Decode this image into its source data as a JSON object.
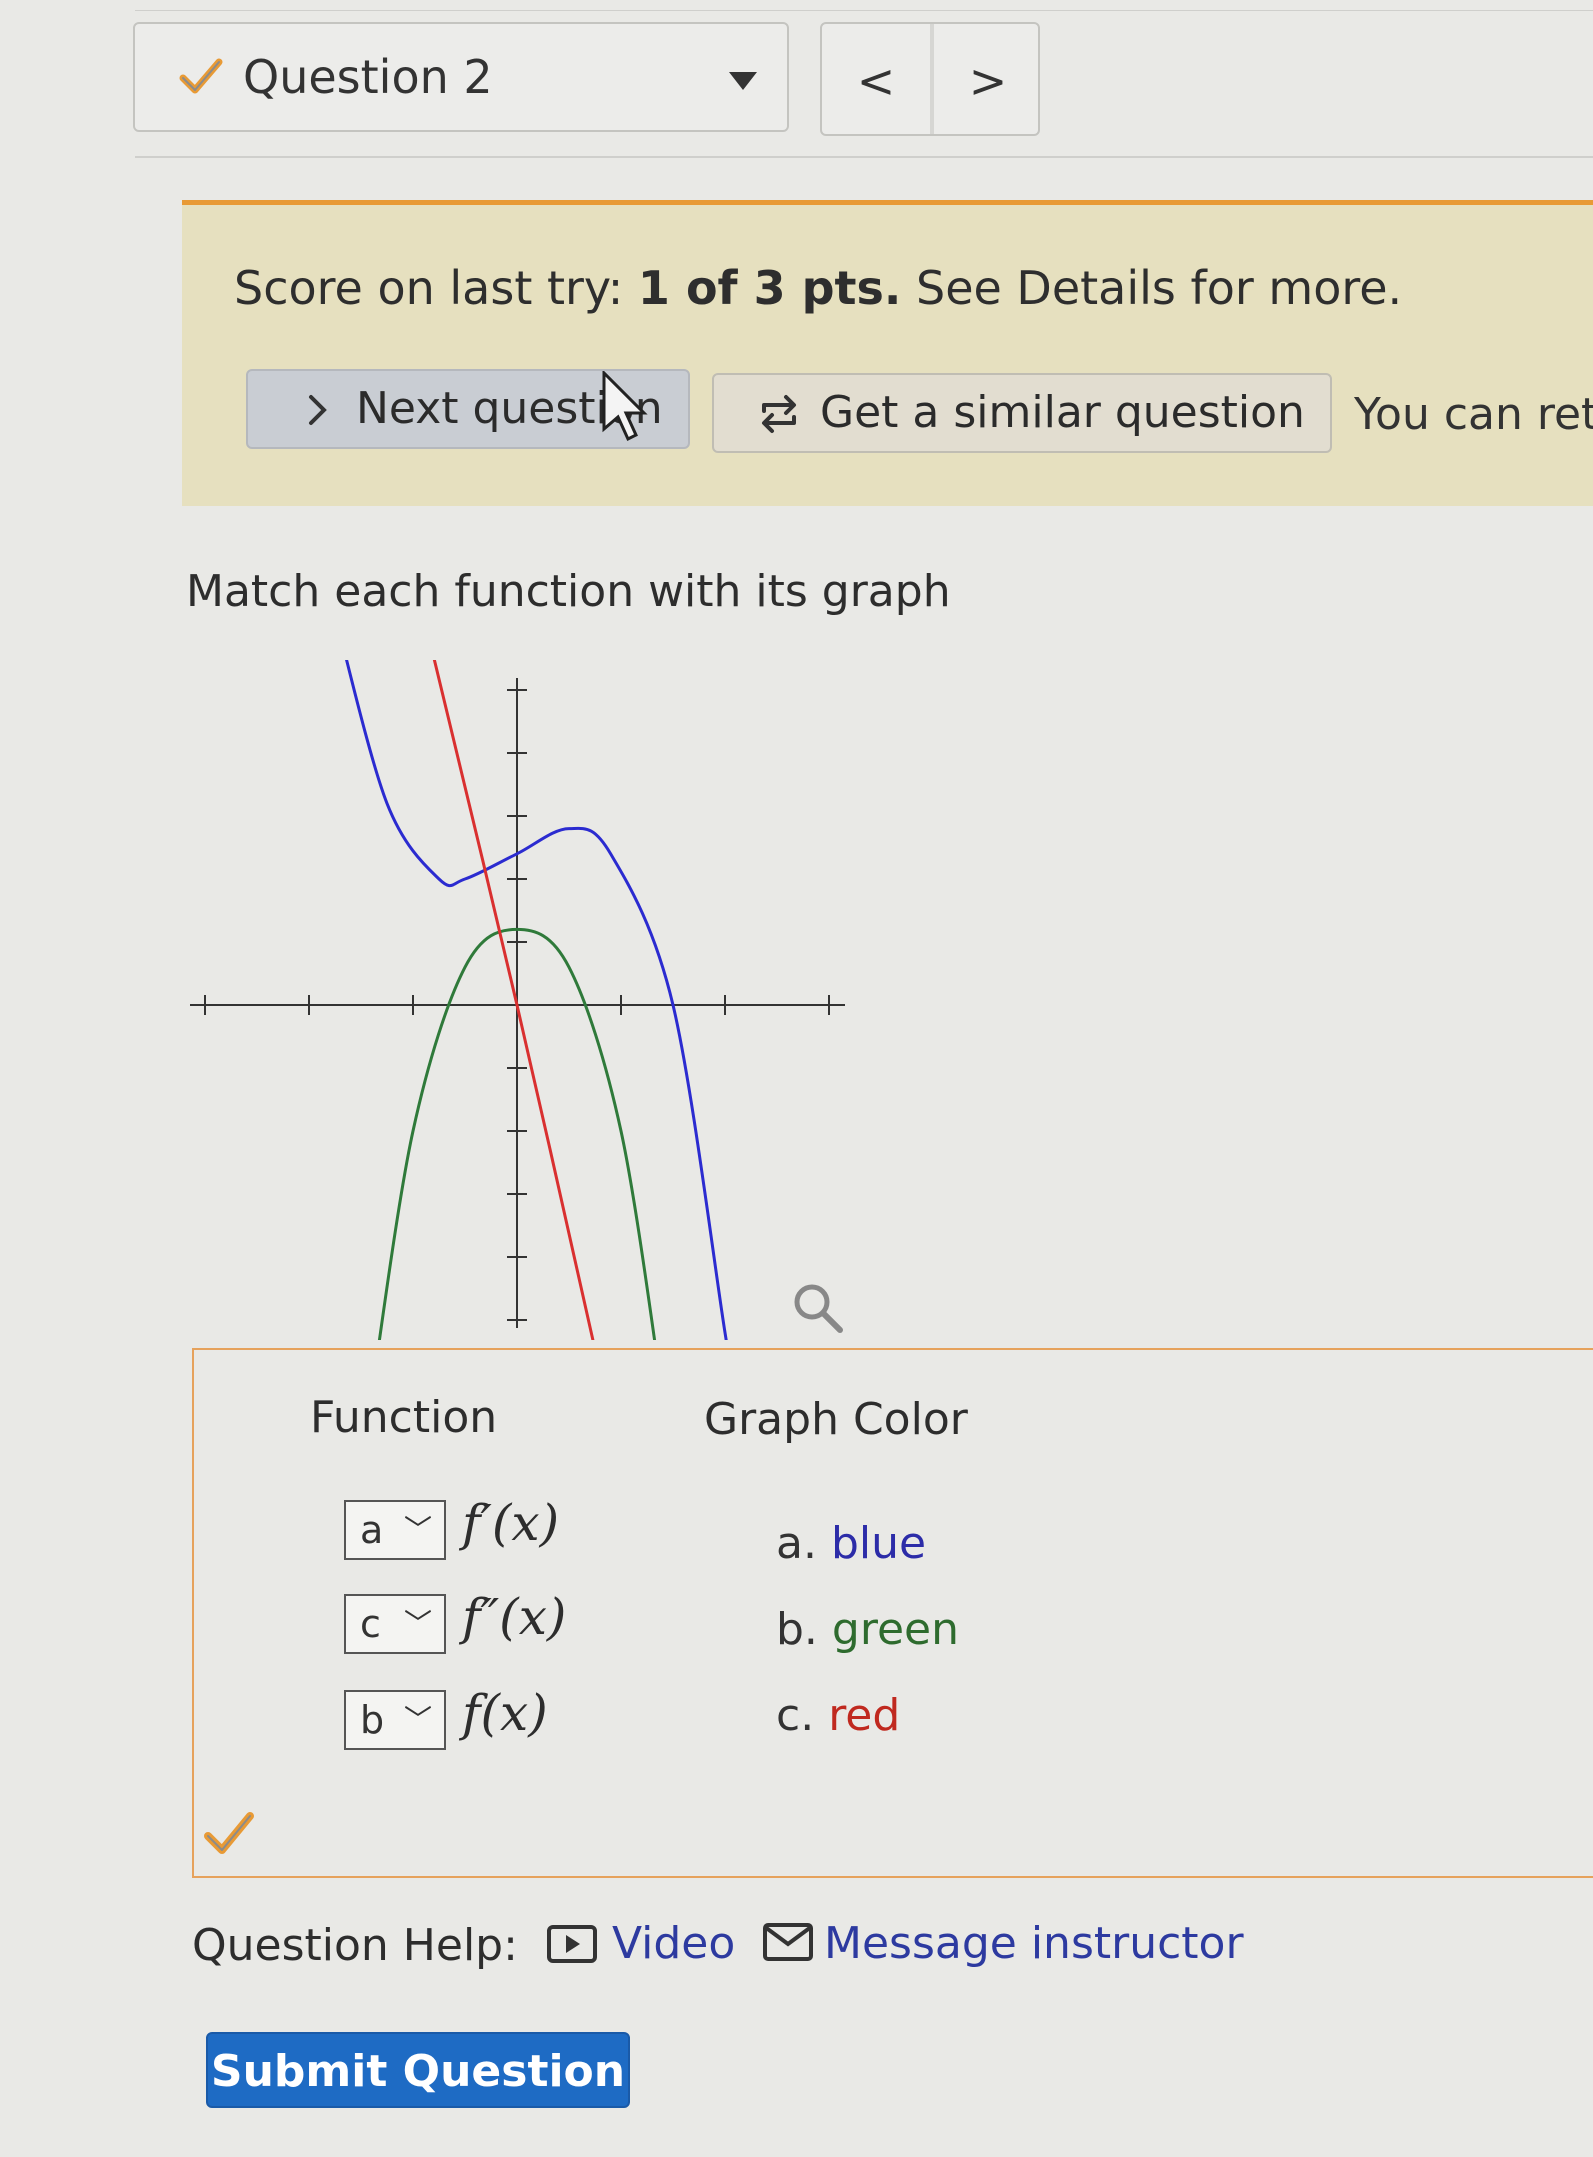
{
  "nav": {
    "question_label": "Question 2",
    "prev_label": "<",
    "next_label": ">"
  },
  "banner": {
    "score_prefix": "Score on last try: ",
    "score_value": "1 of 3 pts.",
    "score_suffix": " See Details for more.",
    "next_question": "Next question",
    "similar_question": "Get a similar question",
    "retry_text": "You can ret"
  },
  "prompt": "Match each function with its graph",
  "chart_data": {
    "type": "line",
    "title": "",
    "xlim": [
      -3,
      3
    ],
    "ylim": [
      -3,
      3
    ],
    "series": [
      {
        "color": "blue",
        "x": [
          -1.75,
          -1.25,
          -0.75,
          -0.5,
          0,
          0.5,
          0.9,
          1.5,
          2.0,
          2.1
        ],
        "y": [
          3.1,
          1.6,
          1.0,
          1.0,
          1.2,
          1.4,
          1.2,
          0.0,
          -2.6,
          -3.1
        ]
      },
      {
        "color": "green",
        "x": [
          -1.4,
          -1.0,
          -0.5,
          0,
          0.5,
          1.0,
          1.4
        ],
        "y": [
          -3.1,
          -1.0,
          0.3,
          0.6,
          0.3,
          -1.0,
          -3.1
        ]
      },
      {
        "color": "red",
        "x": [
          -0.9,
          0,
          0.85
        ],
        "y": [
          3.1,
          0.0,
          -3.1
        ]
      }
    ],
    "grid": false
  },
  "match": {
    "function_header": "Function",
    "color_header": "Graph Color",
    "rows": [
      {
        "selected": "a",
        "fn": "f′(x)"
      },
      {
        "selected": "c",
        "fn": "f″(x)"
      },
      {
        "selected": "b",
        "fn": "f(x)"
      }
    ],
    "options": [
      {
        "letter": "a.",
        "color": "blue"
      },
      {
        "letter": "b.",
        "color": "green"
      },
      {
        "letter": "c.",
        "color": "red"
      }
    ]
  },
  "help": {
    "label": "Question Help:",
    "video": "Video",
    "message": "Message instructor"
  },
  "submit_label": "Submit Question",
  "colors": {
    "accent_orange": "#e89a35",
    "banner_bg": "#e6e0bf",
    "submit_blue": "#1e6bc4",
    "curve_blue": "#2b2bd0",
    "curve_green": "#2f7a3a",
    "curve_red": "#d93030"
  }
}
